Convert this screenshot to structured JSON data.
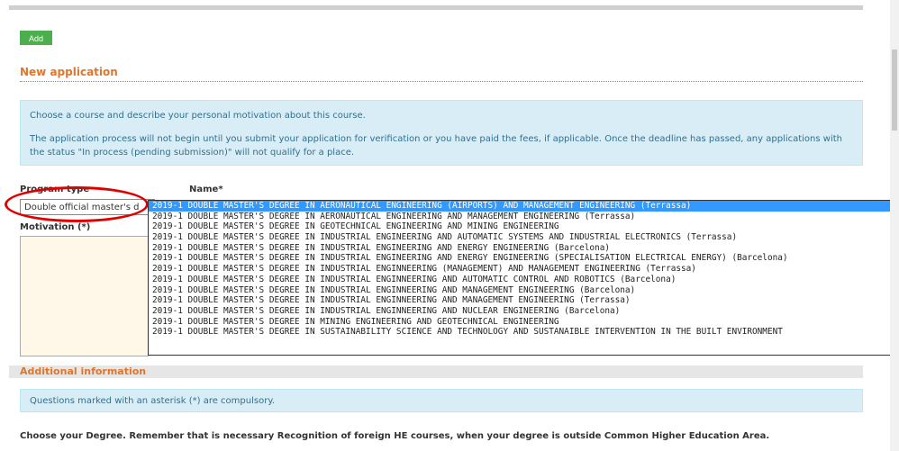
{
  "toolbar": {
    "add_label": "Add"
  },
  "form": {
    "section_title": "New application",
    "info_lines": [
      "Choose a course and describe your personal motivation about this course.",
      "The application process will not begin until you submit your application for verification or you have paid the fees, if applicable. Once the deadline has passed, any applications with the status \"In process (pending submission)\" will not qualify for a place."
    ],
    "program_type_label": "Program type",
    "program_type_value": "Double official master's d",
    "name_label": "Name*",
    "motivation_label": "Motivation (*)"
  },
  "dropdown": {
    "options": [
      "2019-1 DOUBLE MASTER'S DEGREE IN AERONAUTICAL ENGINEERING (AIRPORTS) AND MANAGEMENT ENGINEERING (Terrassa)",
      "2019-1 DOUBLE MASTER'S DEGREE IN AERONAUTICAL ENGINEERING AND MANAGEMENT ENGINEERING (Terrassa)",
      "2019-1 DOUBLE MASTER'S DEGREE IN GEOTECHNICAL ENGINEERING AND MINING ENGINEERING",
      "2019-1 DOUBLE MASTER'S DEGREE IN INDUSTRIAL ENGINEERING AND AUTOMATIC SYSTEMS AND INDUSTRIAL ELECTRONICS (Terrassa)",
      "2019-1 DOUBLE MASTER'S DEGREE IN INDUSTRIAL ENGINEERING AND ENERGY ENGINEERING (Barcelona)",
      "2019-1 DOUBLE MASTER'S DEGREE IN INDUSTRIAL ENGINEERING AND ENERGY ENGINEERING (SPECIALISATION ELECTRICAL ENERGY) (Barcelona)",
      "2019-1 DOUBLE MASTER'S DEGREE IN INDUSTRIAL ENGINNEERING (MANAGEMENT) AND MANAGEMENT ENGINEERING (Terrassa)",
      "2019-1 DOUBLE MASTER'S DEGREE IN INDUSTRIAL ENGINNEERING AND AUTOMATIC CONTROL AND ROBOTICS (Barcelona)",
      "2019-1 DOUBLE MASTER'S DEGREE IN INDUSTRIAL ENGINNEERING AND MANAGEMENT ENGINEERING (Barcelona)",
      "2019-1 DOUBLE MASTER'S DEGREE IN INDUSTRIAL ENGINNEERING AND MANAGEMENT ENGINEERING (Terrassa)",
      "2019-1 DOUBLE MASTER'S DEGREE IN INDUSTRIAL ENGINNEERING AND NUCLEAR ENGINEERING (Barcelona)",
      "2019-1 DOUBLE MASTER'S DEGREE IN MINING ENGINEERING AND GEOTECHNICAL ENGINEERING",
      "2019-1 DOUBLE MASTER'S DEGREE IN SUSTAINABILITY SCIENCE AND TECHNOLOGY AND SUSTANAIBLE INTERVENTION IN THE BUILT ENVIRONMENT"
    ],
    "selected_index": 0
  },
  "additional": {
    "title": "Additional information",
    "note": "Questions marked with an asterisk (*) are compulsory.",
    "degree_question": "Choose your Degree. Remember that is necessary Recognition of foreign HE courses, when your degree is outside Common Higher Education Area."
  },
  "colors": {
    "accent": "#e0762b",
    "add_button": "#4cae4c",
    "info_bg": "#d9edf7",
    "highlight": "#3399ff",
    "annotation": "#e00000"
  }
}
